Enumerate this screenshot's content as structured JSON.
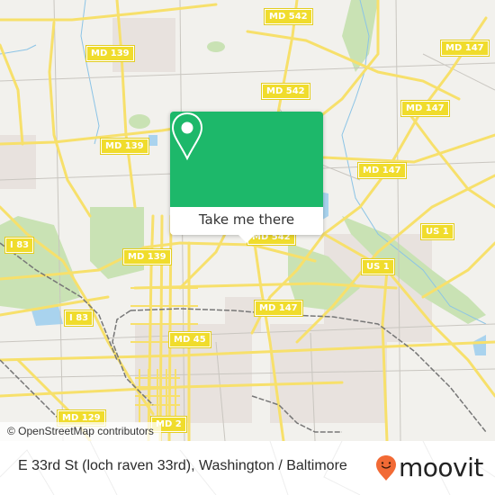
{
  "map": {
    "colors": {
      "background": "#f2f1ed",
      "road": "#f7e06b",
      "minor_road": "#c9c6c0",
      "park": "#c9e2b4",
      "water": "#a9d3ee",
      "urban": "#e8e2de",
      "shield": "#f0dc2c",
      "rail": "#777777"
    },
    "shields": [
      {
        "id": "md542-top",
        "label": "MD 542"
      },
      {
        "id": "md147-top-right",
        "label": "MD 147"
      },
      {
        "id": "md139-upper",
        "label": "MD 139"
      },
      {
        "id": "md542-mid",
        "label": "MD 542"
      },
      {
        "id": "md147-right-1",
        "label": "MD 147"
      },
      {
        "id": "md139-mid",
        "label": "MD 139"
      },
      {
        "id": "md147-right-2",
        "label": "MD 147"
      },
      {
        "id": "i83-upper",
        "label": "I 83"
      },
      {
        "id": "us1-right",
        "label": "US 1"
      },
      {
        "id": "md139-lower",
        "label": "MD 139"
      },
      {
        "id": "us1-center",
        "label": "US 1"
      },
      {
        "id": "md147-center",
        "label": "MD 147"
      },
      {
        "id": "i83-lower",
        "label": "I 83"
      },
      {
        "id": "md45",
        "label": "MD 45"
      },
      {
        "id": "md129",
        "label": "MD 129"
      },
      {
        "id": "md2",
        "label": "MD 2"
      },
      {
        "id": "md542-popup",
        "label": "MD 542"
      }
    ],
    "attribution": "© OpenStreetMap contributors"
  },
  "popup": {
    "icon": "map-pin-icon",
    "button_label": "Take me there",
    "color": "#1db86a"
  },
  "footer": {
    "title": "E 33rd St (loch raven 33rd), Washington / Baltimore",
    "brand": "moovit",
    "brand_icon": "moovit-pin-icon",
    "brand_color": "#f26a35"
  }
}
